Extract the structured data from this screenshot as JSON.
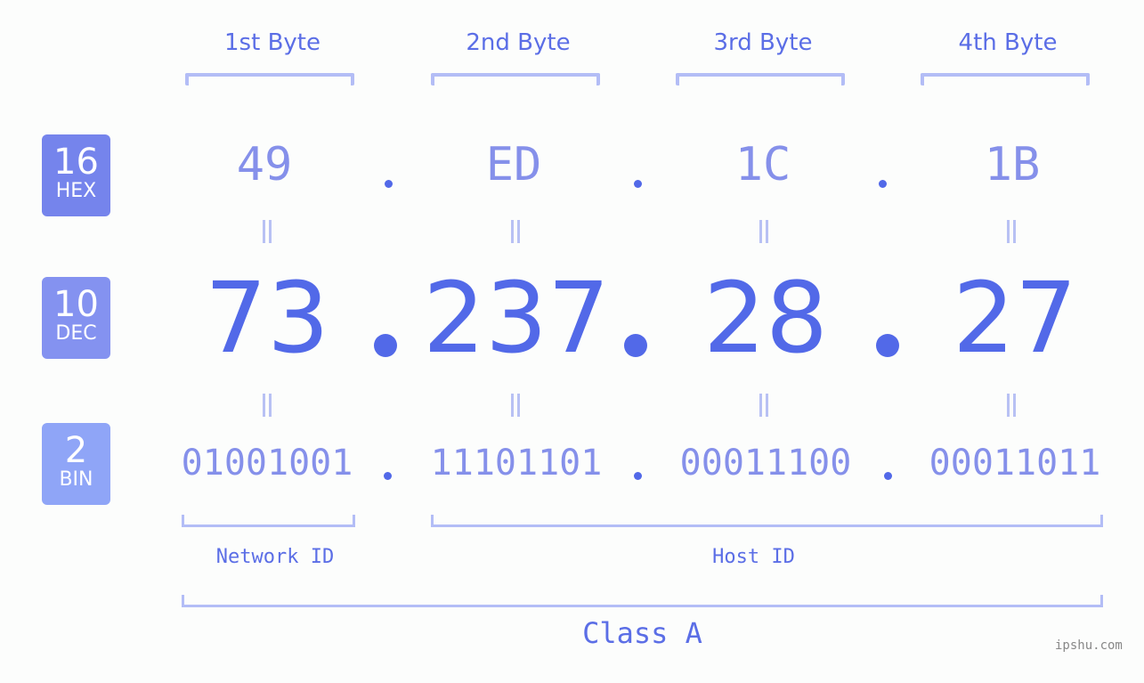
{
  "colors": {
    "accent": "#5269e8",
    "hex_badge": "#7584ec",
    "dec_badge": "#8492f0",
    "bin_badge": "#8fa5f7",
    "bracket": "#b3bdf6",
    "muted_value": "#8590ea"
  },
  "byte_headers": [
    "1st Byte",
    "2nd Byte",
    "3rd Byte",
    "4th Byte"
  ],
  "rows": {
    "hex": {
      "base": "16",
      "name": "HEX",
      "values": [
        "49",
        "ED",
        "1C",
        "1B"
      ]
    },
    "dec": {
      "base": "10",
      "name": "DEC",
      "values": [
        "73",
        "237",
        "28",
        "27"
      ]
    },
    "bin": {
      "base": "2",
      "name": "BIN",
      "values": [
        "01001001",
        "11101101",
        "00011100",
        "00011011"
      ]
    }
  },
  "separator": ".",
  "equals_icon": "equals-vertical-icon",
  "segments": {
    "network_id": "Network ID",
    "host_id": "Host ID"
  },
  "ip_class": "Class A",
  "watermark": "ipshu.com"
}
